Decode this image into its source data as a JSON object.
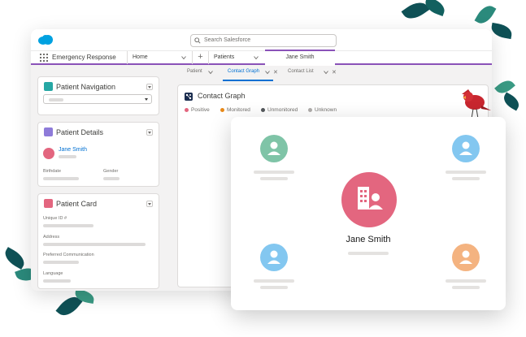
{
  "header": {
    "search_placeholder": "Search Salesforce"
  },
  "nav": {
    "app_name": "Emergency Response",
    "tabs": [
      {
        "label": "Home"
      },
      {
        "label": "Patients"
      }
    ],
    "active_tab": "Jane Smith"
  },
  "subtabs": [
    {
      "label": "Patient"
    },
    {
      "label": "Contact Graph"
    },
    {
      "label": "Contact List"
    }
  ],
  "cards": {
    "navigation": {
      "title": "Patient Navigation"
    },
    "details": {
      "title": "Patient Details",
      "patient_name": "Jane Smith",
      "fields": [
        "Birthdate",
        "Gender"
      ]
    },
    "patient_card": {
      "title": "Patient Card",
      "fields": [
        "Unique ID #",
        "Address",
        "Preferred Communication",
        "Language"
      ]
    }
  },
  "graph": {
    "title": "Contact Graph",
    "legend": [
      {
        "label": "Positive",
        "color": "#e3667f"
      },
      {
        "label": "Monitored",
        "color": "#e88a1a"
      },
      {
        "label": "Unmonitored",
        "color": "#54585c"
      },
      {
        "label": "Unknown",
        "color": "#b0adab"
      }
    ]
  },
  "popup": {
    "center_name": "Jane Smith",
    "node_colors": {
      "center": "#e3667f",
      "top_left": "#7fc4a7",
      "top_right": "#83c7f0",
      "bottom_left": "#83c7f0",
      "bottom_right": "#f4b380"
    }
  },
  "colors": {
    "accent": "#8a52b8",
    "link": "#0070d2"
  }
}
